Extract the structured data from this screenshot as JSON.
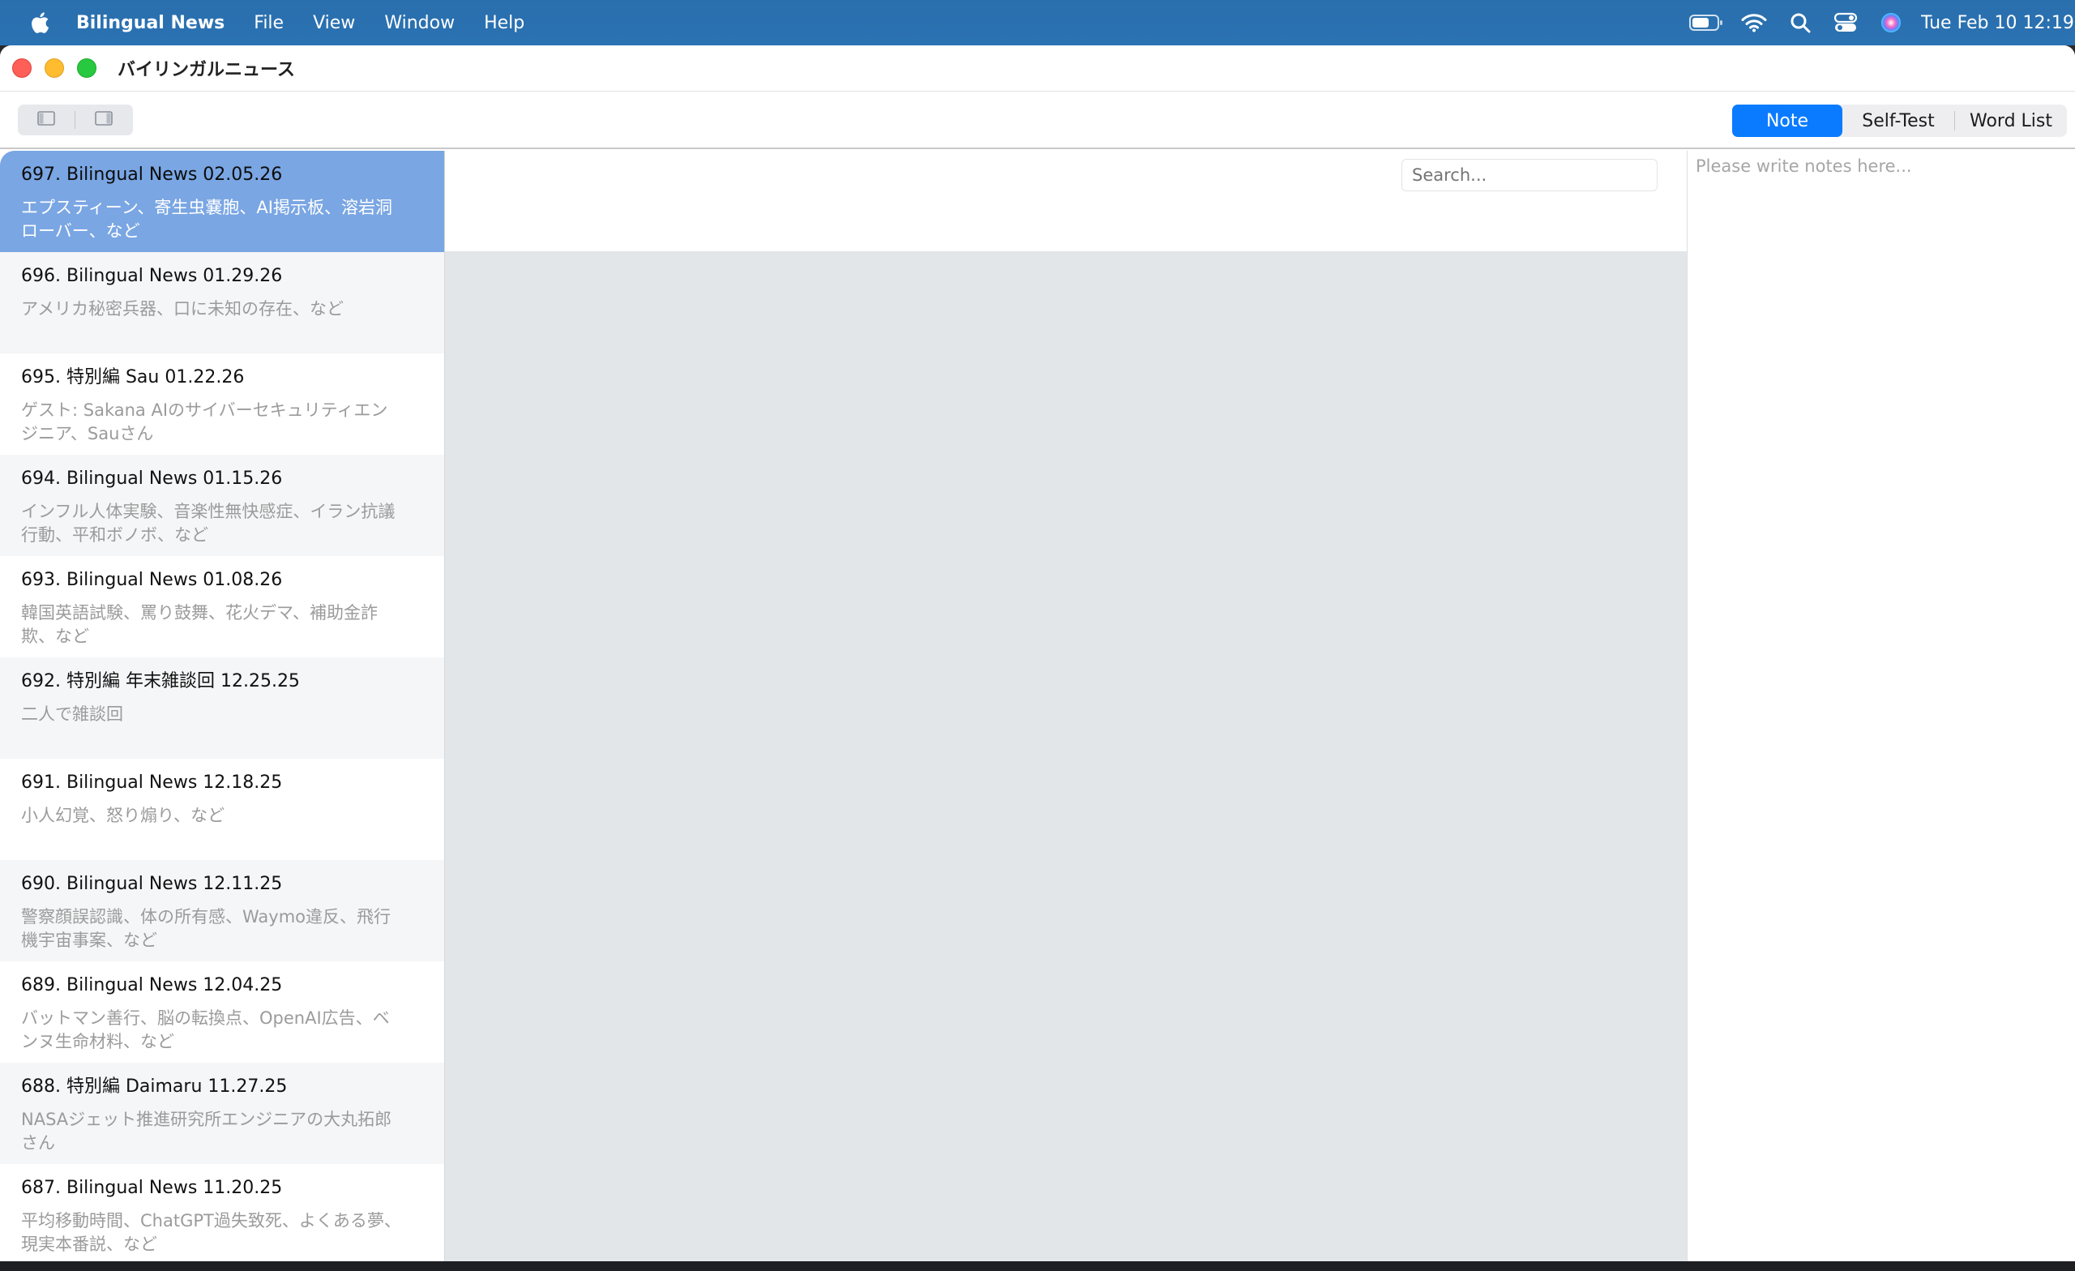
{
  "menubar": {
    "apple_icon": "apple-logo-icon",
    "app_name": "Bilingual News",
    "menus": [
      "File",
      "View",
      "Window",
      "Help"
    ],
    "status_icons": [
      "battery-icon",
      "wifi-icon",
      "search-icon",
      "control-center-icon",
      "siri-icon"
    ],
    "clock": "Tue Feb 10  12:19"
  },
  "window": {
    "title": "バイリンガルニュース"
  },
  "toolbar": {
    "left_sidebar_toggle_icon": "sidebar-left-icon",
    "right_sidebar_toggle_icon": "sidebar-right-icon",
    "segments": [
      "Note",
      "Self-Test",
      "Word List"
    ],
    "selected_segment": "Note",
    "accent_color": "#0a7bff"
  },
  "episodes": [
    {
      "title": "697. Bilingual News 02.05.26",
      "subtitle": "エプスティーン、寄生虫嚢胞、AI掲示板、溶岩洞ローバー、など",
      "selected": true
    },
    {
      "title": "696. Bilingual News 01.29.26",
      "subtitle": "アメリカ秘密兵器、口に未知の存在、など"
    },
    {
      "title": "695. 特別編 Sau 01.22.26",
      "subtitle": "ゲスト: Sakana AIのサイバーセキュリティエンジニア、Sauさん"
    },
    {
      "title": "694. Bilingual News 01.15.26",
      "subtitle": "インフル人体実験、音楽性無快感症、イラン抗議行動、平和ボノボ、など"
    },
    {
      "title": "693. Bilingual News 01.08.26",
      "subtitle": "韓国英語試験、罵り鼓舞、花火デマ、補助金詐欺、など"
    },
    {
      "title": "692. 特別編 年末雑談回 12.25.25",
      "subtitle": "二人で雑談回"
    },
    {
      "title": "691. Bilingual News 12.18.25",
      "subtitle": "小人幻覚、怒り煽り、など"
    },
    {
      "title": "690. Bilingual News 12.11.25",
      "subtitle": "警察顔誤認識、体の所有感、Waymo違反、飛行機宇宙事案、など"
    },
    {
      "title": "689. Bilingual News 12.04.25",
      "subtitle": "バットマン善行、脳の転換点、OpenAI広告、ベンヌ生命材料、など"
    },
    {
      "title": "688. 特別編 Daimaru 11.27.25",
      "subtitle": "NASAジェット推進研究所エンジニアの大丸拓郎さん"
    },
    {
      "title": "687. Bilingual News 11.20.25",
      "subtitle": "平均移動時間、ChatGPT過失致死、よくある夢、現実本番説、など"
    }
  ],
  "center": {
    "search_placeholder": "Search..."
  },
  "notes": {
    "placeholder": "Please write notes here..."
  }
}
